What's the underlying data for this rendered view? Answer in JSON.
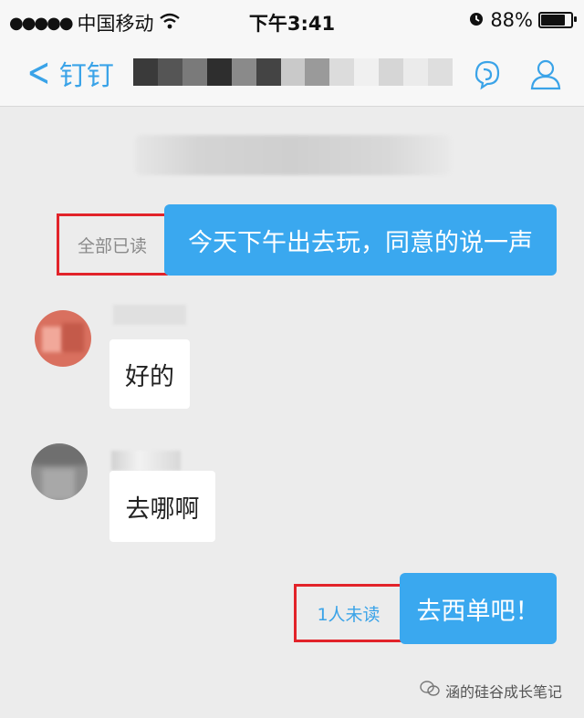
{
  "status_bar": {
    "signal": "●●●●●",
    "carrier": "中国移动",
    "time": "下午3:41",
    "battery": "88%",
    "battery_level": 0.88
  },
  "nav": {
    "back_label": "钉钉"
  },
  "messages": [
    {
      "side": "right",
      "text": "今天下午出去玩，同意的说一声",
      "read_status": "全部已读"
    },
    {
      "side": "left",
      "text": "好的"
    },
    {
      "side": "left",
      "text": "去哪啊"
    },
    {
      "side": "right",
      "text": "去西单吧！",
      "read_status": "1人未读"
    }
  ],
  "watermark": "涵的硅谷成长笔记",
  "colors": {
    "accent": "#3aa8ef",
    "highlight_box": "#e2232a",
    "read_all_text": "#8a8a8a",
    "unread_text": "#3aa3e8"
  }
}
